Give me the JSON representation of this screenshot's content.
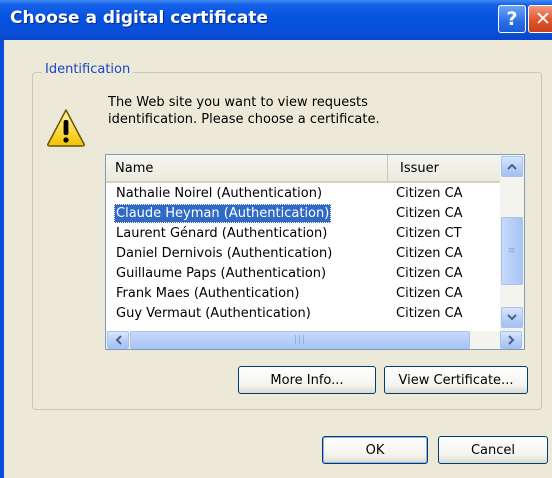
{
  "window": {
    "title": "Choose a digital certificate"
  },
  "titlebar": {
    "help_glyph": "?",
    "close_glyph": "✕"
  },
  "group": {
    "label": "Identification"
  },
  "message": {
    "text": "The Web site you want to view requests identification. Please choose a certificate."
  },
  "list": {
    "columns": [
      "Name",
      "Issuer"
    ],
    "rows": [
      {
        "name": "Nathalie Noirel (Authentication)",
        "issuer": "Citizen CA",
        "selected": false
      },
      {
        "name": "Claude Heyman (Authentication)",
        "issuer": "Citizen CA",
        "selected": true
      },
      {
        "name": "Laurent Génard (Authentication)",
        "issuer": "Citizen CT",
        "selected": false
      },
      {
        "name": "Daniel Dernivois (Authentication)",
        "issuer": "Citizen CA",
        "selected": false
      },
      {
        "name": "Guillaume Paps (Authentication)",
        "issuer": "Citizen CA",
        "selected": false
      },
      {
        "name": "Frank Maes (Authentication)",
        "issuer": "Citizen CA",
        "selected": false
      },
      {
        "name": "Guy Vermaut (Authentication)",
        "issuer": "Citizen CA",
        "selected": false
      }
    ]
  },
  "buttons": {
    "more_info": "More Info...",
    "view_certificate": "View Certificate...",
    "ok": "OK",
    "cancel": "Cancel"
  },
  "icons": {
    "warning": "warning-icon",
    "help": "help-icon",
    "close": "close-icon"
  },
  "colors": {
    "titlebar": "#0a4fd9",
    "selection": "#316ac5",
    "group_label": "#1a46c8",
    "dialog_bg": "#ece9d8"
  }
}
